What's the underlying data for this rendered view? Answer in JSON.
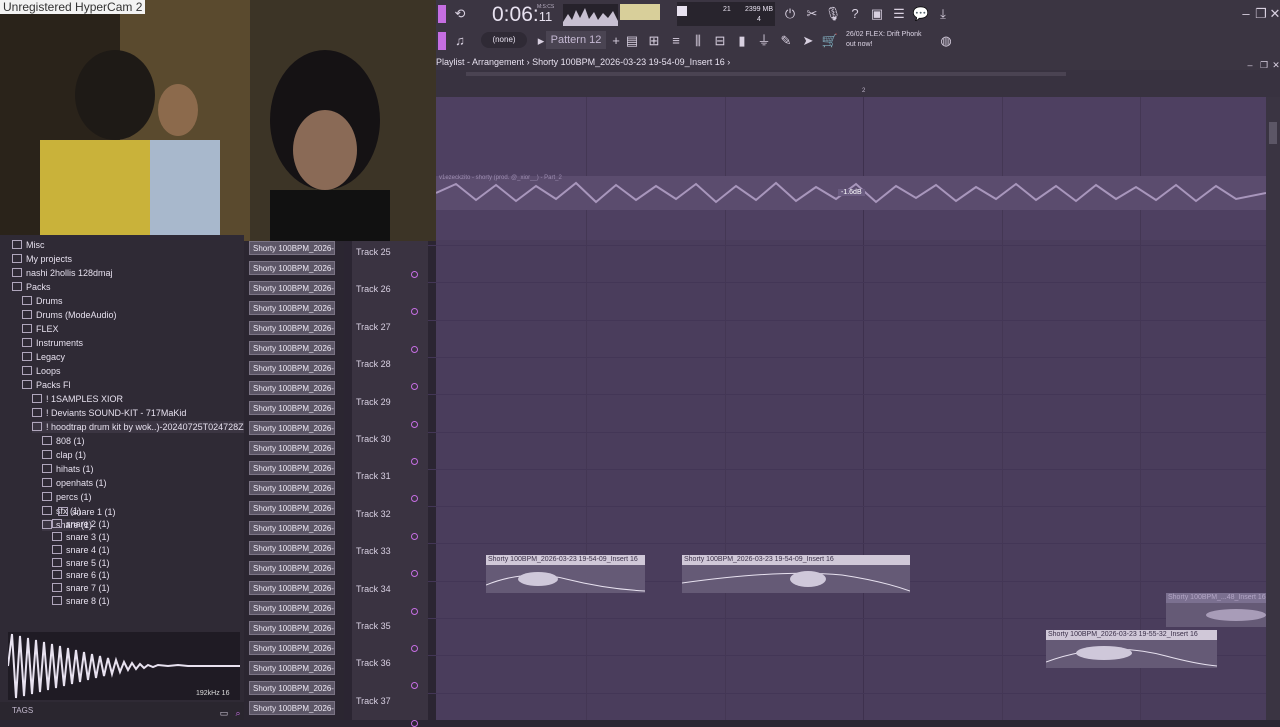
{
  "webcam": {
    "title": "Unregistered HyperCam 2"
  },
  "toolbar": {
    "time_main": "0:06:",
    "time_small": "11",
    "time_unit": "M:S:CS",
    "cpu_value": "21",
    "ram_value": "2399 MB",
    "poly_value": "4",
    "none_select": "(none)",
    "pattern_select": "Pattern 12",
    "news_date": "26/02",
    "news_line1": "FLEX: Drift Phonk",
    "news_line2": "out now!"
  },
  "playlist": {
    "title_prefix": "Playlist - Arrangement",
    "title_sep": "›",
    "title_song": "Shorty 100BPM_2026-03-23 19-54-09_Insert 16",
    "title_end": "›",
    "ruler_marker": "2",
    "audio_clip_label": "v1ezeckzito - shorty (prod. @_xior__) - Part_2",
    "audio_db": "-1.6dB"
  },
  "browser": {
    "items": [
      {
        "label": "Misc",
        "indent": 0
      },
      {
        "label": "My projects",
        "indent": 0
      },
      {
        "label": "nashi 2hollis 128dmaj",
        "indent": 0
      },
      {
        "label": "Packs",
        "indent": 0
      },
      {
        "label": "Drums",
        "indent": 1
      },
      {
        "label": "Drums (ModeAudio)",
        "indent": 1
      },
      {
        "label": "FLEX",
        "indent": 1
      },
      {
        "label": "Instruments",
        "indent": 1
      },
      {
        "label": "Legacy",
        "indent": 1
      },
      {
        "label": "Loops",
        "indent": 1
      },
      {
        "label": "Packs Fl",
        "indent": 1
      },
      {
        "label": "! 1SAMPLES XIOR",
        "indent": 2
      },
      {
        "label": "! Deviants SOUND-KIT - 717MaKid",
        "indent": 2
      },
      {
        "label": "! hoodtrap drum kit by wok..)-20240725T024728Z-001",
        "indent": 2
      },
      {
        "label": "808 (1)",
        "indent": 3
      },
      {
        "label": "clap (1)",
        "indent": 3
      },
      {
        "label": "hihats (1)",
        "indent": 3
      },
      {
        "label": "openhats (1)",
        "indent": 3
      },
      {
        "label": "percs (1)",
        "indent": 3
      },
      {
        "label": "sfx (1)",
        "indent": 3
      },
      {
        "label": "snare (1)",
        "indent": 3
      },
      {
        "label": "snare 1 (1)",
        "indent": 5
      },
      {
        "label": "snare 2 (1)",
        "indent": 4
      },
      {
        "label": "snare 3 (1)",
        "indent": 4
      },
      {
        "label": "snare 4 (1)",
        "indent": 4
      },
      {
        "label": "snare 5 (1)",
        "indent": 4
      },
      {
        "label": "snare 6 (1)",
        "indent": 4
      },
      {
        "label": "snare 7 (1)",
        "indent": 4
      },
      {
        "label": "snare 8 (1)",
        "indent": 4
      }
    ],
    "sample_info": "192kHz 16",
    "tags_label": "TAGS"
  },
  "picker": {
    "item_label": "Shorty 100BPM_2026-03...",
    "count": 24
  },
  "tracks": [
    "Track 25",
    "Track 26",
    "Track 27",
    "Track 28",
    "Track 29",
    "Track 30",
    "Track 31",
    "Track 32",
    "Track 33",
    "Track 34",
    "Track 35",
    "Track 36",
    "Track 37"
  ],
  "clips": [
    {
      "label": "Shorty 100BPM_2026-03-23 19-54-09_Insert 16"
    },
    {
      "label": "Shorty 100BPM_2026-03-23 19-54-09_Insert 16"
    },
    {
      "label": "Shorty 100BPM_2026-03-23 19-55-32_Insert 16"
    },
    {
      "label": "Shorty 100BPM_...48_Insert 16"
    }
  ],
  "colors": {
    "accent": "#c56ee2",
    "grid": "#4a3d5c",
    "clip": "#655a76"
  }
}
